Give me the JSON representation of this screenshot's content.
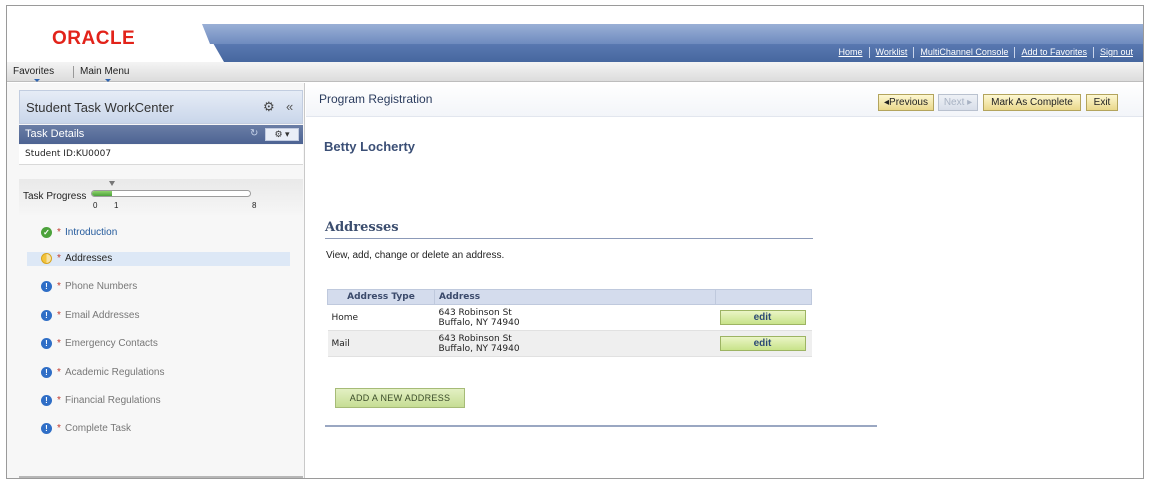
{
  "header": {
    "logo_text": "ORACLE",
    "links": [
      "Home",
      "Worklist",
      "MultiChannel Console",
      "Add to Favorites",
      "Sign out"
    ]
  },
  "menubar": {
    "favorites": "Favorites",
    "main_menu": "Main Menu"
  },
  "left_panel": {
    "title": "Student Task WorkCenter",
    "collapse_glyph": "«",
    "gear_glyph": "⚙",
    "task_details": "Task Details",
    "refresh_glyph": "↻",
    "task_menu_glyph": "⚙ ▾",
    "student_id": "Student ID:KU0007",
    "progress": {
      "label": "Task Progress",
      "min": "0",
      "current": "1",
      "max": "8",
      "fraction": 0.125
    },
    "tasks": [
      {
        "star": "*",
        "label": "Introduction",
        "status": "done",
        "icon": "check-icon"
      },
      {
        "star": "*",
        "label": "Addresses",
        "status": "in-progress",
        "icon": "half-circle-icon"
      },
      {
        "star": "*",
        "label": "Phone Numbers",
        "status": "pending",
        "icon": "info-icon"
      },
      {
        "star": "*",
        "label": "Email Addresses",
        "status": "pending",
        "icon": "info-icon"
      },
      {
        "star": "*",
        "label": "Emergency Contacts",
        "status": "pending",
        "icon": "info-icon"
      },
      {
        "star": "*",
        "label": "Academic Regulations",
        "status": "pending",
        "icon": "info-icon"
      },
      {
        "star": "*",
        "label": "Financial Regulations",
        "status": "pending",
        "icon": "info-icon"
      },
      {
        "star": "*",
        "label": "Complete Task",
        "status": "pending",
        "icon": "info-icon"
      }
    ]
  },
  "main": {
    "title": "Program Registration",
    "buttons": {
      "previous": "◂Previous",
      "next": "Next ▸",
      "mark_complete": "Mark As Complete",
      "exit": "Exit"
    },
    "student_name": "Betty Locherty",
    "section_title": "Addresses",
    "instructions": "View, add, change or delete an address.",
    "table": {
      "headers": [
        "Address Type",
        "Address",
        ""
      ],
      "rows": [
        {
          "type": "Home",
          "line1": "643 Robinson St",
          "line2": "Buffalo, NY 74940",
          "action": "edit"
        },
        {
          "type": "Mail",
          "line1": "643 Robinson St",
          "line2": "Buffalo, NY 74940",
          "action": "edit"
        }
      ]
    },
    "add_button": "ADD A NEW ADDRESS"
  },
  "colors": {
    "oracle_red": "#e2231a",
    "banner_blue": "#5877b0",
    "task_header_blue": "#4d6393",
    "progress_green": "#4ca23b",
    "nav_button_yellow": "#ead88b",
    "grid_header": "#d4dced"
  }
}
